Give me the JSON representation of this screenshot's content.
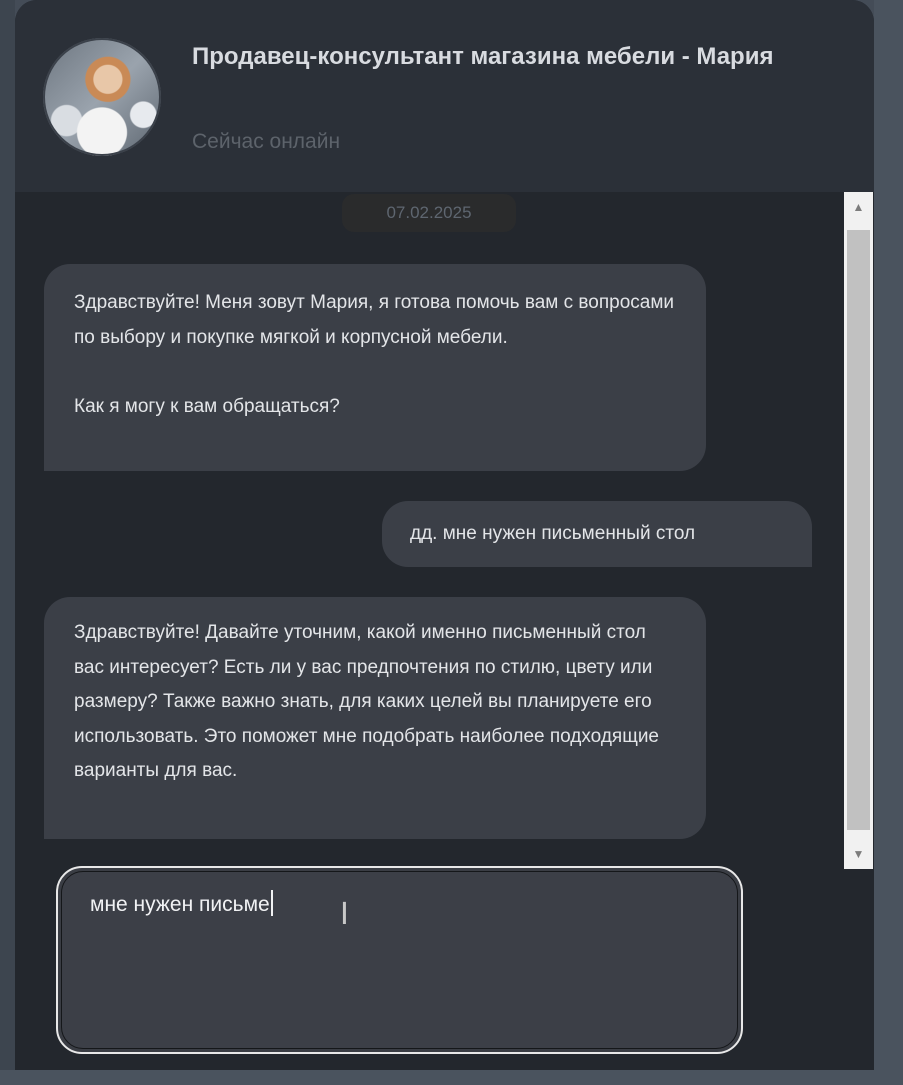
{
  "header": {
    "title": "Продавец-консультант магазина мебели - Мария",
    "status": "Сейчас онлайн",
    "avatar_icon": "avatar-photo"
  },
  "chat": {
    "date": "07.02.2025",
    "messages": [
      {
        "direction": "incoming",
        "text": "Здравствуйте! Меня зовут Мария, я готова помочь вам с вопросами по выбору и покупке мягкой и корпусной мебели.\n\nКак я могу к вам обращаться?"
      },
      {
        "direction": "outgoing",
        "text": "дд. мне нужен письменный стол"
      },
      {
        "direction": "incoming",
        "text": "Здравствуйте! Давайте уточним, какой именно письменный стол вас интересует? Есть ли у вас предпочтения по стилю, цвету или размеру? Также важно знать, для каких целей вы планируете его использовать. Это поможет мне подобрать наиболее подходящие варианты для вас."
      }
    ]
  },
  "composer": {
    "value": "мне нужен письме"
  },
  "scrollbar": {
    "up_icon": "▲",
    "down_icon": "▼"
  },
  "colors": {
    "window_bg": "#23272d",
    "header_bg": "#2b3038",
    "bubble_bg": "#3b3f47",
    "text": "#e3e5e8"
  }
}
